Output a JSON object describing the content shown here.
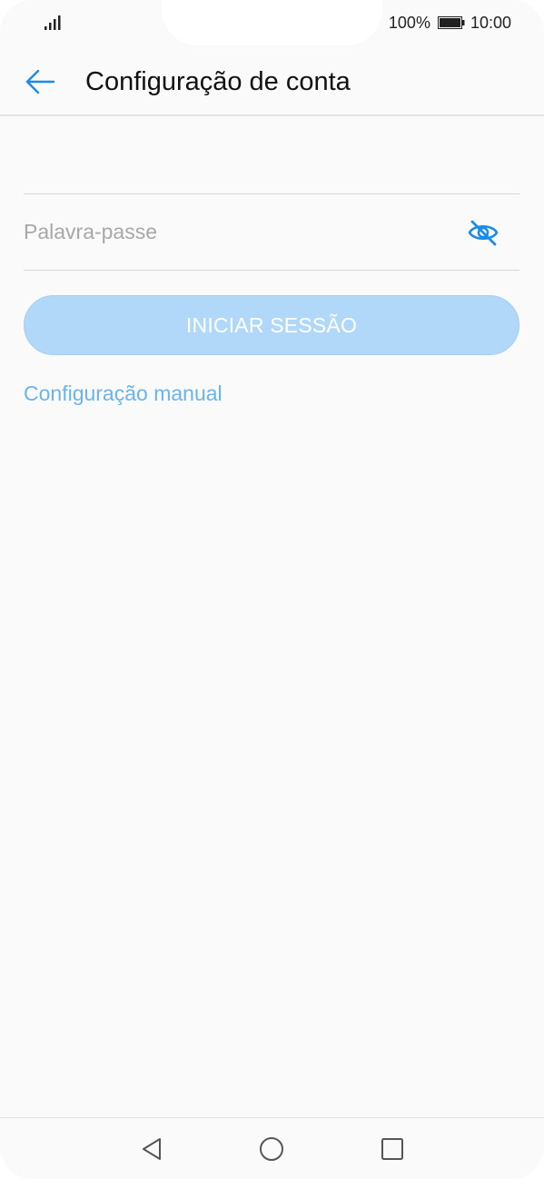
{
  "status_bar": {
    "battery_percent": "100%",
    "time": "10:00",
    "battery_level": 1.0,
    "signal_icon": "signal-bars-icon",
    "battery_icon": "battery-icon"
  },
  "app_bar": {
    "back_icon": "arrow-left-icon",
    "title": "Configuração de conta"
  },
  "form": {
    "password": {
      "placeholder": "Palavra-passe",
      "value": "",
      "toggle_icon": "eye-off-icon"
    },
    "login_button_label": "INICIAR SESSÃO",
    "manual_link_label": "Configuração manual"
  },
  "nav_bar": {
    "back_icon": "triangle-back-icon",
    "home_icon": "circle-home-icon",
    "recents_icon": "square-recents-icon"
  },
  "colors": {
    "accent": "#1a8be8",
    "button_disabled": "#b1d8f9",
    "link": "#6bb3ec",
    "background": "#fafafa"
  }
}
